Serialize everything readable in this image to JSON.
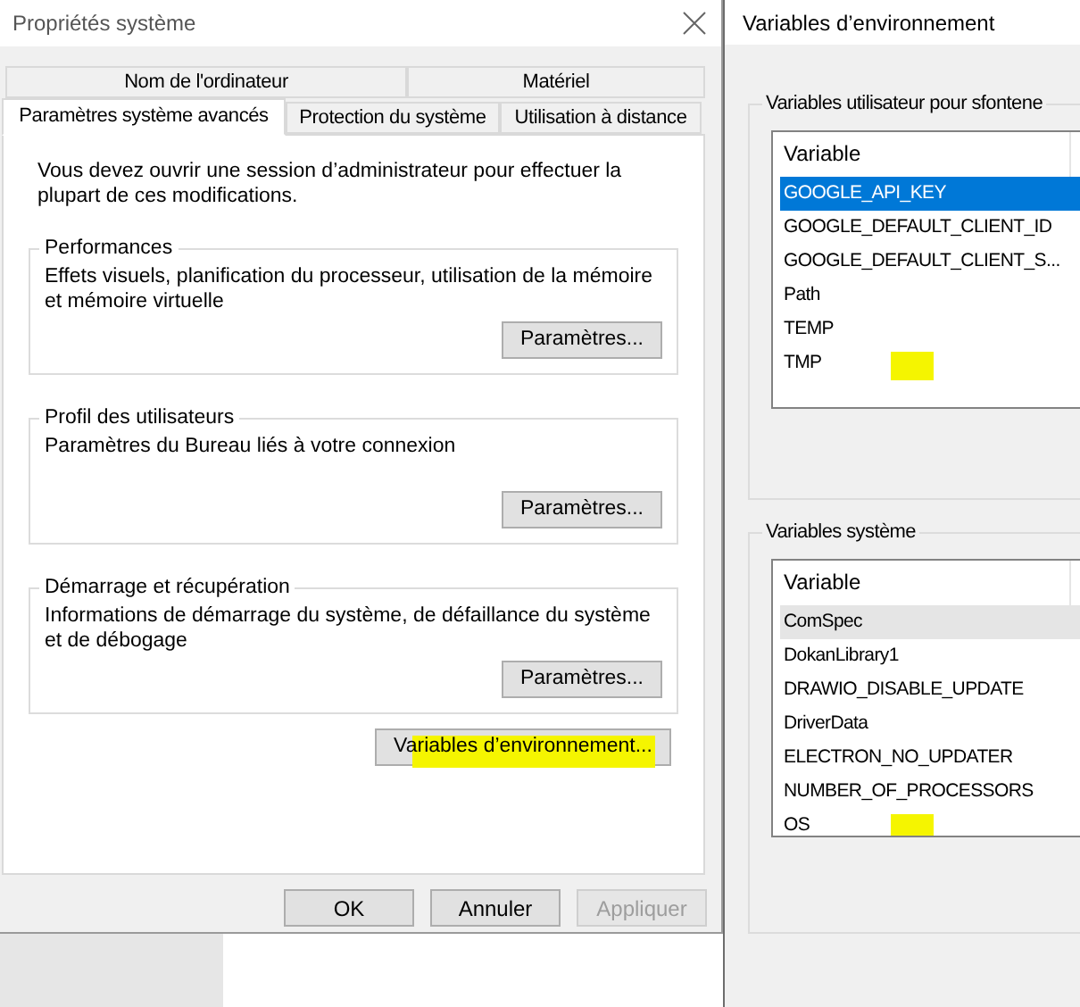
{
  "system_properties": {
    "title": "Propriétés système",
    "tabs_row_1": [
      {
        "label": "Nom de l'ordinateur",
        "selected": false
      },
      {
        "label": "Matériel",
        "selected": false
      }
    ],
    "tabs_row_2": [
      {
        "label": "Paramètres système avancés",
        "selected": true
      },
      {
        "label": "Protection du système",
        "selected": false
      },
      {
        "label": "Utilisation à distance",
        "selected": false
      }
    ],
    "notice": "Vous devez ouvrir une session d’administrateur pour effectuer la plupart de ces modifications.",
    "groups": [
      {
        "title": "Performances",
        "description": "Effets visuels, planification du processeur, utilisation de la mémoire et mémoire virtuelle",
        "button": "Paramètres..."
      },
      {
        "title": "Profil des utilisateurs",
        "description": "Paramètres du Bureau liés à votre connexion",
        "button": "Paramètres..."
      },
      {
        "title": "Démarrage et récupération",
        "description": "Informations de démarrage du système, de défaillance du système et de débogage",
        "button": "Paramètres..."
      }
    ],
    "env_button": {
      "label": "Variables d’environnement...",
      "highlighted": true
    },
    "buttons": [
      {
        "label": "OK",
        "disabled": false
      },
      {
        "label": "Annuler",
        "disabled": false
      },
      {
        "label": "Appliquer",
        "disabled": true
      }
    ]
  },
  "environment_variables": {
    "title": "Variables d’environnement",
    "lists": [
      {
        "title": "Variables utilisateur pour sfontene",
        "column": "Variable",
        "focused": true,
        "rows": [
          {
            "name": "GOOGLE_API_KEY",
            "selected": true,
            "highlighted": false
          },
          {
            "name": "GOOGLE_DEFAULT_CLIENT_ID",
            "selected": false,
            "highlighted": false
          },
          {
            "name": "GOOGLE_DEFAULT_CLIENT_S...",
            "selected": false,
            "highlighted": false
          },
          {
            "name": "Path",
            "selected": false,
            "highlighted": false
          },
          {
            "name": "TEMP",
            "selected": false,
            "highlighted": false
          },
          {
            "name": "TMP",
            "selected": false,
            "highlighted": true
          }
        ]
      },
      {
        "title": "Variables système",
        "column": "Variable",
        "focused": false,
        "rows": [
          {
            "name": "ComSpec",
            "selected": true,
            "highlighted": false
          },
          {
            "name": "DokanLibrary1",
            "selected": false,
            "highlighted": false
          },
          {
            "name": "DRAWIO_DISABLE_UPDATE",
            "selected": false,
            "highlighted": false
          },
          {
            "name": "DriverData",
            "selected": false,
            "highlighted": false
          },
          {
            "name": "ELECTRON_NO_UPDATER",
            "selected": false,
            "highlighted": false
          },
          {
            "name": "NUMBER_OF_PROCESSORS",
            "selected": false,
            "highlighted": false
          },
          {
            "name": "OS",
            "selected": false,
            "highlighted": true
          }
        ]
      }
    ]
  }
}
